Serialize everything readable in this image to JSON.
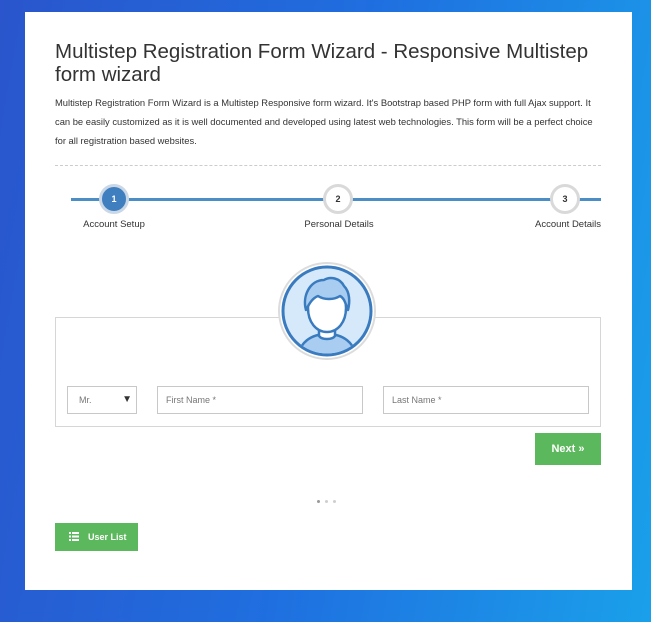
{
  "header": {
    "title": "Multistep Registration Form Wizard - Responsive Multistep form wizard",
    "description": "Multistep Registration Form Wizard is a Multistep Responsive form wizard. It's Bootstrap based PHP form with full Ajax support. It can be easily customized as it is well documented and developed using latest web technologies. This form will be a perfect choice for all registration based websites."
  },
  "steps": [
    {
      "number": "1",
      "label": "Account Setup",
      "active": true
    },
    {
      "number": "2",
      "label": "Personal Details",
      "active": false
    },
    {
      "number": "3",
      "label": "Account Details",
      "active": false
    }
  ],
  "form": {
    "title_select": "Mr.",
    "first_name_placeholder": "First Name *",
    "last_name_placeholder": "Last Name *"
  },
  "buttons": {
    "next": "Next »",
    "user_list": "User List"
  },
  "pager": {
    "total": 3,
    "current": 1
  },
  "colors": {
    "accent": "#3f7fbf",
    "button": "#5cb85c",
    "background_gradient": [
      "#2a55cc",
      "#1aa0ea"
    ]
  },
  "icons": [
    "user-avatar-icon",
    "list-icon",
    "chevron-right-icon",
    "caret-down-icon"
  ]
}
